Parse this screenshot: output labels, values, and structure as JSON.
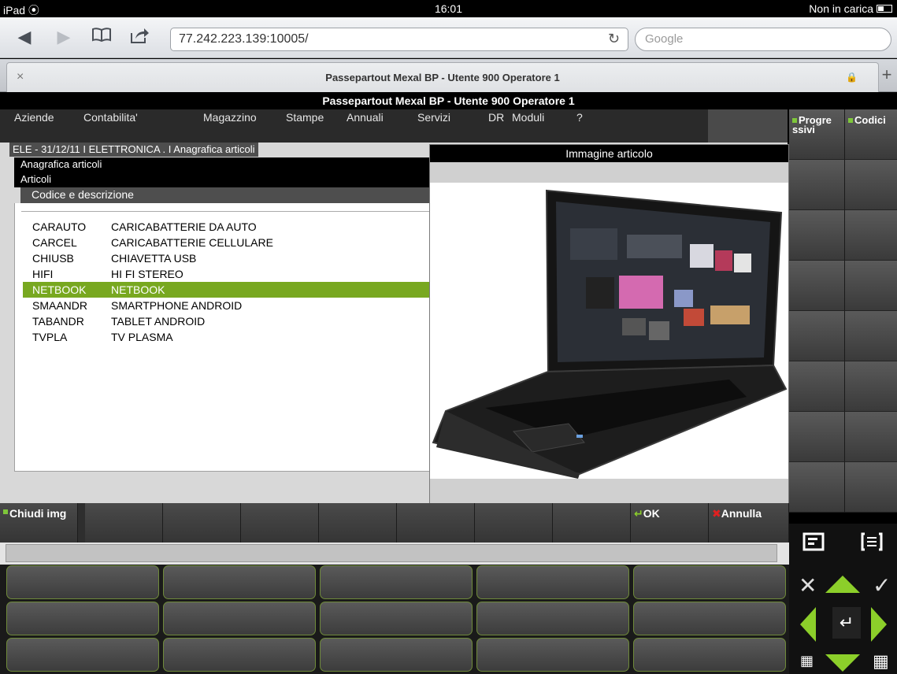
{
  "status_bar": {
    "device": "iPad",
    "time": "16:01",
    "battery_text": "Non in carica"
  },
  "browser": {
    "url": "77.242.223.139:10005/",
    "search_placeholder": "Google",
    "tab_title": "Passepartout Mexal BP - Utente 900 Operatore 1",
    "tab_close": "×",
    "new_tab": "+"
  },
  "app": {
    "title": "Passepartout Mexal BP - Utente 900 Operatore 1",
    "menu": [
      "Aziende",
      "Contabilita'",
      "Magazzino",
      "Stampe",
      "Annuali",
      "Servizi",
      "DR",
      "Moduli",
      "?"
    ],
    "breadcrumb": "ELE - 31/12/11 I ELETTRONICA . I Anagrafica articoli",
    "panel_title": "Anagrafica articoli",
    "panel_subtitle": "Articoli",
    "list_header": "Codice e descrizione",
    "items": [
      {
        "code": "CARAUTO",
        "desc": "CARICABATTERIE DA AUTO"
      },
      {
        "code": "CARCEL",
        "desc": "CARICABATTERIE CELLULARE"
      },
      {
        "code": "CHIUSB",
        "desc": "CHIAVETTA USB"
      },
      {
        "code": "HIFI",
        "desc": "HI FI STEREO"
      },
      {
        "code": "NETBOOK",
        "desc": "NETBOOK"
      },
      {
        "code": "SMAANDR",
        "desc": "SMARTPHONE ANDROID"
      },
      {
        "code": "TABANDR",
        "desc": "TABLET ANDROID"
      },
      {
        "code": "TVPLA",
        "desc": "TV PLASMA"
      }
    ],
    "selected_code": "NETBOOK",
    "image_window_title": "Immagine articolo",
    "side_buttons": {
      "progressivi": "Progre\nssivi",
      "codici": "Codici"
    },
    "function_keys": {
      "chiudi_img": "Chiudi img",
      "ok": "OK",
      "annulla": "Annulla"
    }
  },
  "colors": {
    "selection": "#78a820",
    "accent_green": "#8ccf2a",
    "cancel_red": "#e02020"
  }
}
